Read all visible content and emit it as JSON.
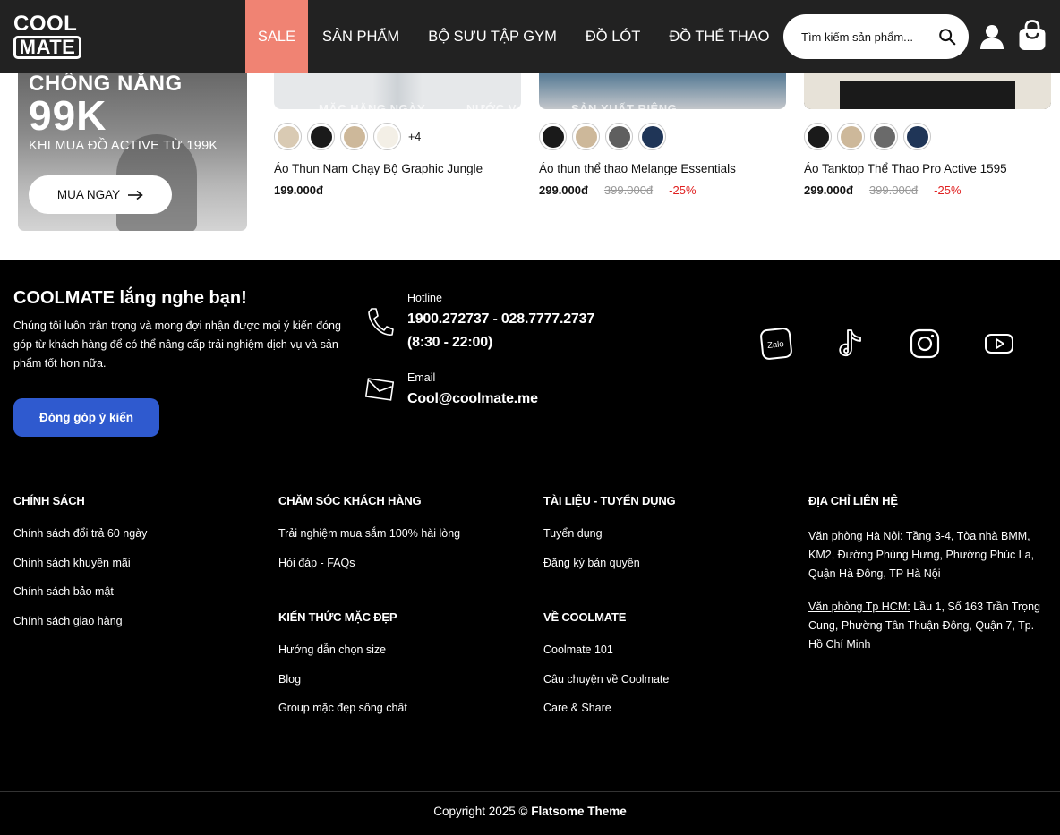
{
  "header": {
    "logo_line1": "COOL",
    "logo_line2": "MATE",
    "nav": [
      "SALE",
      "SẢN PHẨM",
      "BỘ SƯU TẬP GYM",
      "ĐỒ LÓT",
      "ĐỒ THỂ THAO"
    ],
    "search_placeholder": "Tìm kiếm sản phẩm...",
    "accent_color": "#f08373"
  },
  "banner": {
    "line1": "CHỐNG NẮNG",
    "line2": "99K",
    "line3": "KHI MUA ĐỒ ACTIVE TỪ 199K",
    "button": "MUA NGAY"
  },
  "products": [
    {
      "ghost_texts": [
        "MẶC HẰNG NGÀY",
        "NƯỚC V"
      ],
      "swatches": [
        "#d9cab3",
        "#1a1a1a",
        "#cdb89a",
        "#f3efe6"
      ],
      "more": "+4",
      "name": "Áo Thun Nam Chạy Bộ Graphic Jungle",
      "price": "199.000đ",
      "old_price": "",
      "discount": ""
    },
    {
      "ghost_texts": [
        "SẢN XUẤT RIÊNG"
      ],
      "swatches": [
        "#1a1a1a",
        "#cdb89a",
        "#5f5f5f",
        "#1f3557"
      ],
      "more": "",
      "name": "Áo thun thể thao Melange Essentials",
      "price": "299.000đ",
      "old_price": "399.000đ",
      "discount": "-25%"
    },
    {
      "ghost_texts": [],
      "swatches": [
        "#1a1a1a",
        "#cdb89a",
        "#6a6a6a",
        "#1f3557"
      ],
      "more": "",
      "name": "Áo Tanktop Thể Thao Pro Active 1595",
      "price": "299.000đ",
      "old_price": "399.000đ",
      "discount": "-25%"
    }
  ],
  "footer": {
    "title": "COOLMATE lắng nghe bạn!",
    "desc": "Chúng tôi luôn trân trọng và mong đợi nhận được mọi ý kiến đóng góp từ khách hàng để có thể nâng cấp trải nghiệm dịch vụ và sản phẩm tốt hơn nữa.",
    "button": "Đóng góp ý kiến",
    "hotline_label": "Hotline",
    "hotline_line1": "1900.272737 - 028.7777.2737",
    "hotline_line2": "(8:30 - 22:00)",
    "email_label": "Email",
    "email": "Cool@coolmate.me",
    "zalo_text": "Zalo",
    "columns": {
      "policy": {
        "title": "CHÍNH SÁCH",
        "links": [
          "Chính sách đổi trả 60 ngày",
          "Chính sách khuyến mãi",
          "Chính sách bảo mật",
          "Chính sách giao hàng"
        ]
      },
      "care": {
        "title": "CHĂM SÓC KHÁCH HÀNG",
        "links": [
          "Trải nghiệm mua sắm 100% hài lòng",
          "Hỏi đáp - FAQs"
        ],
        "title2": "KIẾN THỨC MẶC ĐẸP",
        "links2": [
          "Hướng dẫn chọn size",
          "Blog",
          "Group mặc đẹp sống chất"
        ]
      },
      "docs": {
        "title": "TÀI LIỆU - TUYỂN DỤNG",
        "links": [
          "Tuyển dụng",
          "Đăng ký bản quyền"
        ],
        "title2": "VỀ COOLMATE",
        "links2": [
          "Coolmate 101",
          "Câu chuyện về Coolmate",
          "Care & Share"
        ]
      },
      "contact": {
        "title": "ĐỊA CHỈ LIÊN HỆ",
        "hn_label": "Văn phòng Hà Nội:",
        "hn_text": " Tầng 3-4, Tòa nhà BMM, KM2, Đường Phùng Hưng, Phường Phúc La, Quận Hà Đông, TP Hà Nội",
        "hcm_label": "Văn phòng Tp HCM:",
        "hcm_text": " Lầu 1, Số 163 Trần Trọng Cung, Phường Tân Thuận Đông, Quận 7, Tp. Hồ Chí Minh"
      }
    },
    "copyright_prefix": "Copyright 2025 © ",
    "copyright_theme": "Flatsome Theme",
    "button_color": "#2f5acf"
  }
}
